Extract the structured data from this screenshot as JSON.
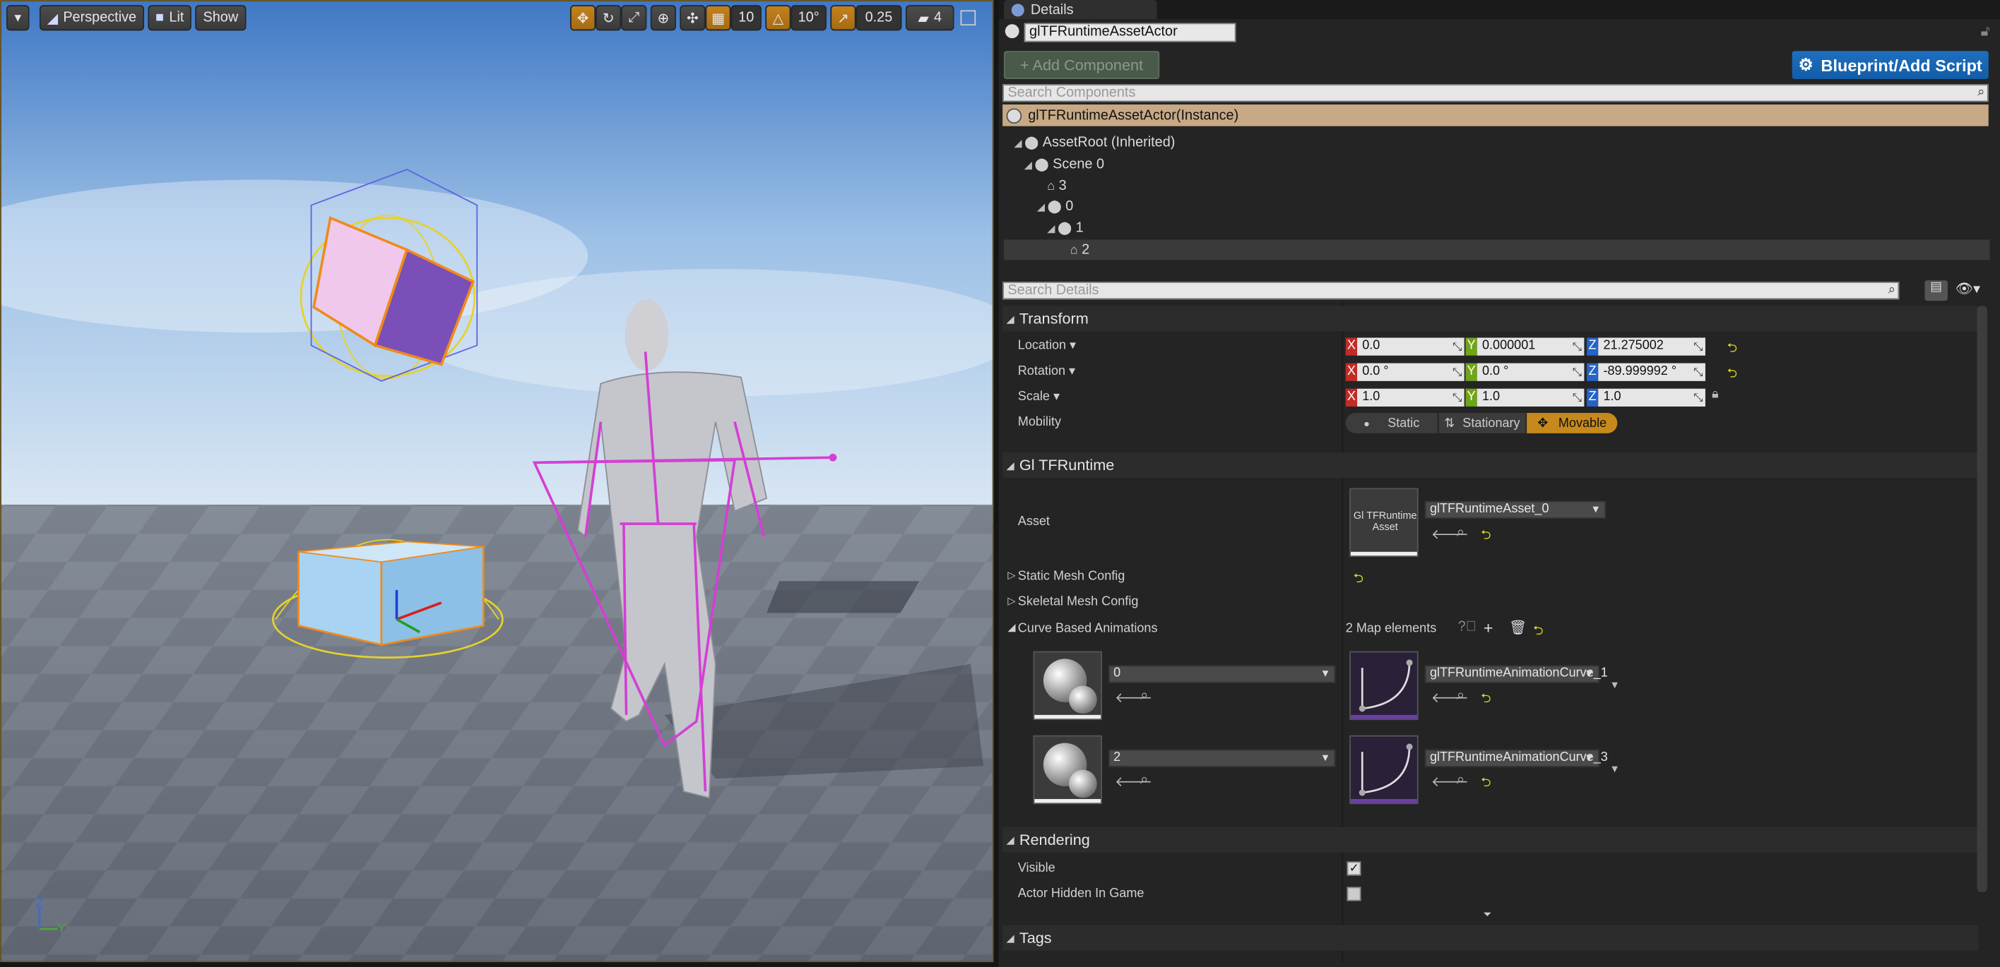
{
  "viewport": {
    "perspective_label": "Perspective",
    "lit_label": "Lit",
    "show_label": "Show",
    "grid_snap_value": "10",
    "rotation_snap_value": "10°",
    "scale_snap_value": "0.25",
    "camera_speed_value": "4",
    "axis_labels": {
      "z": "Z",
      "y": "Y"
    }
  },
  "details": {
    "tab_label": "Details",
    "actor_name": "glTFRuntimeAssetActor",
    "add_component_label": "+ Add Component",
    "blueprint_label": "Blueprint/Add Script",
    "search_components_placeholder": "Search Components",
    "instance_label": "glTFRuntimeAssetActor(Instance)",
    "tree": [
      {
        "label": "AssetRoot (Inherited)"
      },
      {
        "label": "Scene 0"
      },
      {
        "label": "3"
      },
      {
        "label": "0"
      },
      {
        "label": "1"
      },
      {
        "label": "2"
      }
    ],
    "search_details_placeholder": "Search Details",
    "transform": {
      "section_label": "Transform",
      "location_label": "Location",
      "rotation_label": "Rotation",
      "scale_label": "Scale",
      "mobility_label": "Mobility",
      "location": {
        "x": "0.0",
        "y": "0.000001",
        "z": "21.275002"
      },
      "rotation": {
        "x": "0.0 °",
        "y": "0.0 °",
        "z": "-89.999992 °"
      },
      "scale": {
        "x": "1.0",
        "y": "1.0",
        "z": "1.0"
      },
      "mobility_options": [
        "Static",
        "Stationary",
        "Movable"
      ],
      "mobility_selected": "Movable"
    },
    "gltf": {
      "section_label": "Gl TFRuntime",
      "asset_label": "Asset",
      "asset_thumb_text": "Gl TFRuntime Asset",
      "asset_value": "glTFRuntimeAsset_0",
      "static_mesh_label": "Static Mesh Config",
      "skeletal_mesh_label": "Skeletal Mesh Config",
      "curve_anim_label": "Curve Based Animations",
      "map_elements": "2 Map elements",
      "curves": [
        {
          "key": "0",
          "value": "glTFRuntimeAnimationCurve_1"
        },
        {
          "key": "2",
          "value": "glTFRuntimeAnimationCurve_3"
        }
      ]
    },
    "rendering": {
      "section_label": "Rendering",
      "visible_label": "Visible",
      "visible_checked": true,
      "hidden_label": "Actor Hidden In Game",
      "hidden_checked": false
    },
    "tags_label": "Tags"
  },
  "colors": {
    "accent_orange": "#c3821d",
    "blueprint_blue": "#1f6fbf",
    "selection_tan": "#c8a985",
    "axis_x": "#c22b26",
    "axis_y": "#6fa518",
    "axis_z": "#2563c7",
    "skeleton_magenta": "#d43fd4"
  }
}
